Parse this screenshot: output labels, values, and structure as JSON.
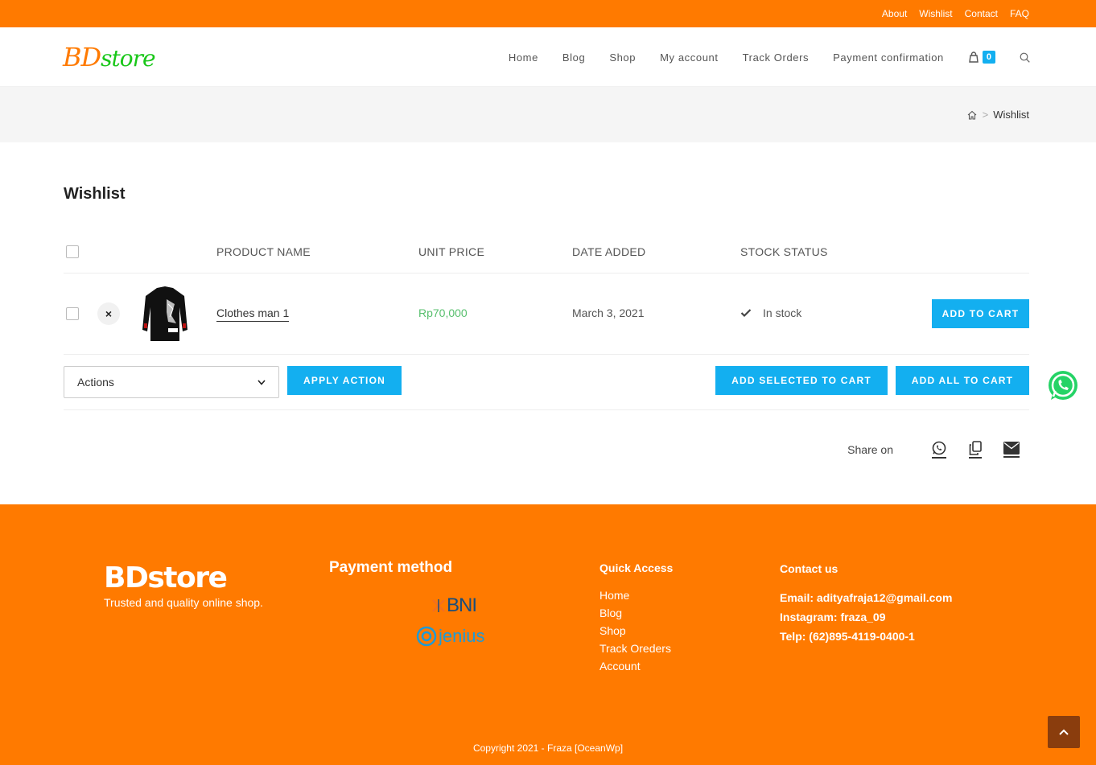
{
  "topbar": {
    "links": [
      "About",
      "Wishlist",
      "Contact",
      "FAQ"
    ]
  },
  "header": {
    "logo_part1": "BD",
    "logo_part2": "store",
    "nav": [
      "Home",
      "Blog",
      "Shop",
      "My account",
      "Track Orders",
      "Payment confirmation"
    ],
    "cart_count": "0"
  },
  "breadcrumb": {
    "current": "Wishlist",
    "separator": ">"
  },
  "main": {
    "title": "Wishlist",
    "columns": [
      "PRODUCT NAME",
      "UNIT PRICE",
      "DATE ADDED",
      "STOCK STATUS"
    ],
    "items": [
      {
        "name": "Clothes man 1",
        "price": "Rp70,000",
        "date": "March 3, 2021",
        "stock": "In stock",
        "add_label": "ADD TO CART",
        "remove_glyph": "×"
      }
    ],
    "actions": {
      "select_value": "Actions",
      "apply_label": "APPLY ACTION",
      "add_selected_label": "ADD SELECTED TO CART",
      "add_all_label": "ADD ALL TO CART"
    },
    "share_label": "Share on"
  },
  "footer": {
    "brand": "BDstore",
    "tagline": "Trusted and quality online shop.",
    "payment_title": "Payment method",
    "bank1": "BNI",
    "bank2": "jenius",
    "quick_title": "Quick Access",
    "quick_links": [
      "Home",
      "Blog",
      "Shop",
      "Track Oreders",
      "Account"
    ],
    "contact_title": "Contact us",
    "contact": [
      "Email: adityafraja12@gmail.com",
      "Instagram: fraza_09",
      "Telp: (62)895-4119-0400-1"
    ],
    "copyright": "Copyright 2021 - Fraza [OceanWp]"
  },
  "colors": {
    "brand_orange": "#ff7a00",
    "accent_blue": "#13aff0",
    "price_green": "#57bf6d",
    "logo_green": "#19c719"
  },
  "icons": [
    "cart-icon",
    "search-icon",
    "home-icon",
    "check-icon",
    "whatsapp-icon",
    "copy-icon",
    "mail-icon",
    "chevron-up-icon"
  ]
}
